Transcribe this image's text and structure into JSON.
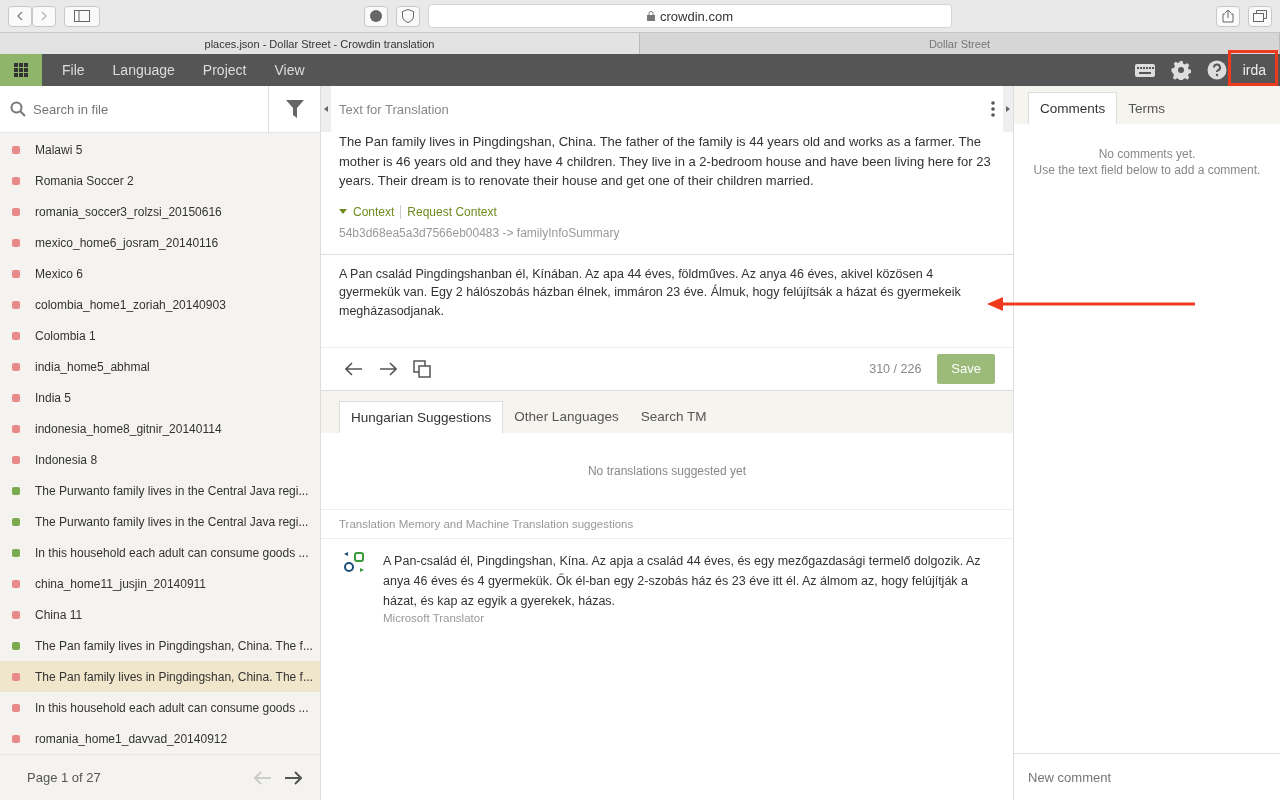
{
  "browser": {
    "address": "crowdin.com",
    "tabs": [
      {
        "title": "places.json - Dollar Street - Crowdin translation",
        "selected": true
      },
      {
        "title": "Dollar Street",
        "selected": false
      }
    ]
  },
  "menu": [
    "File",
    "Language",
    "Project",
    "View"
  ],
  "user": "irda",
  "sidebar": {
    "search": {
      "placeholder": "Search in file"
    },
    "items": [
      {
        "label": "Malawi 5",
        "color": "#e88a8a",
        "selected": false
      },
      {
        "label": "Romania Soccer 2",
        "color": "#e88a8a",
        "selected": false
      },
      {
        "label": "romania_soccer3_rolzsi_20150616",
        "color": "#e88a8a",
        "selected": false
      },
      {
        "label": "mexico_home6_josram_20140116",
        "color": "#e88a8a",
        "selected": false
      },
      {
        "label": "Mexico 6",
        "color": "#e88a8a",
        "selected": false
      },
      {
        "label": "colombia_home1_zoriah_20140903",
        "color": "#e88a8a",
        "selected": false
      },
      {
        "label": "Colombia 1",
        "color": "#e88a8a",
        "selected": false
      },
      {
        "label": "india_home5_abhmal",
        "color": "#e88a8a",
        "selected": false
      },
      {
        "label": "India 5",
        "color": "#e88a8a",
        "selected": false
      },
      {
        "label": "indonesia_home8_gitnir_20140114",
        "color": "#e88a8a",
        "selected": false
      },
      {
        "label": "Indonesia 8",
        "color": "#e88a8a",
        "selected": false
      },
      {
        "label": "The Purwanto family lives in the Central Java regi...",
        "color": "#7aab4e",
        "selected": false
      },
      {
        "label": "The Purwanto family lives in the Central Java regi...",
        "color": "#7aab4e",
        "selected": false
      },
      {
        "label": "In this household each adult can consume goods ...",
        "color": "#7aab4e",
        "selected": false
      },
      {
        "label": "china_home11_jusjin_20140911",
        "color": "#e88a8a",
        "selected": false
      },
      {
        "label": "China 11",
        "color": "#e88a8a",
        "selected": false
      },
      {
        "label": "The Pan family lives in Pingdingshan, China. The f...",
        "color": "#7aab4e",
        "selected": false
      },
      {
        "label": "The Pan family lives in Pingdingshan, China. The f...",
        "color": "#e88a8a",
        "selected": true
      },
      {
        "label": "In this household each adult can consume goods ...",
        "color": "#e88a8a",
        "selected": false
      },
      {
        "label": "romania_home1_davvad_20140912",
        "color": "#e88a8a",
        "selected": false
      }
    ],
    "page": "Page 1 of 27"
  },
  "source": {
    "heading": "Text for Translation",
    "text": "The Pan family lives in Pingdingshan, China. The father of the family is 44 years old and works as a farmer. The mother is 46 years old and they have 4 children. They live in a 2-bedroom house and have been living here for 23 years. Their dream is to renovate their house and get one of their children married.",
    "context": "Context",
    "request_context": "Request Context",
    "key": "54b3d68ea5a3d7566eb00483 -> familyInfoSummary"
  },
  "translation": {
    "value": "A Pan család Pingdingshanban él, Kínában. Az apa 44 éves, földműves. Az anya 46 éves, akivel közösen 4 gyermekük van. Egy 2 hálószobás házban élnek, immáron 23 éve. Álmuk, hogy felújítsák a házat és gyermekeik megházasodjanak.",
    "counter": "310 / 226",
    "save": "Save"
  },
  "suggestion_tabs": [
    {
      "label": "Hungarian Suggestions",
      "selected": true
    },
    {
      "label": "Other Languages",
      "selected": false
    },
    {
      "label": "Search TM",
      "selected": false
    }
  ],
  "suggestions_empty": "No translations suggested yet",
  "mt_heading": "Translation Memory and Machine Translation suggestions",
  "mt": [
    {
      "text": "A Pan-család él, Pingdingshan, Kína. Az apja a család 44 éves, és egy mezőgazdasági termelő dolgozik. Az anya 46 éves és 4 gyermekük. Ők él-ban egy 2-szobás ház és 23 éve itt él. Az álmom az, hogy felújítják a házat, és kap az egyik a gyerekek, házas.",
      "source": "Microsoft Translator"
    }
  ],
  "right_tabs": [
    {
      "label": "Comments",
      "selected": true
    },
    {
      "label": "Terms",
      "selected": false
    }
  ],
  "comments_empty": [
    "No comments yet.",
    "Use the text field below to add a comment."
  ],
  "comment_field": {
    "placeholder": "New comment"
  }
}
